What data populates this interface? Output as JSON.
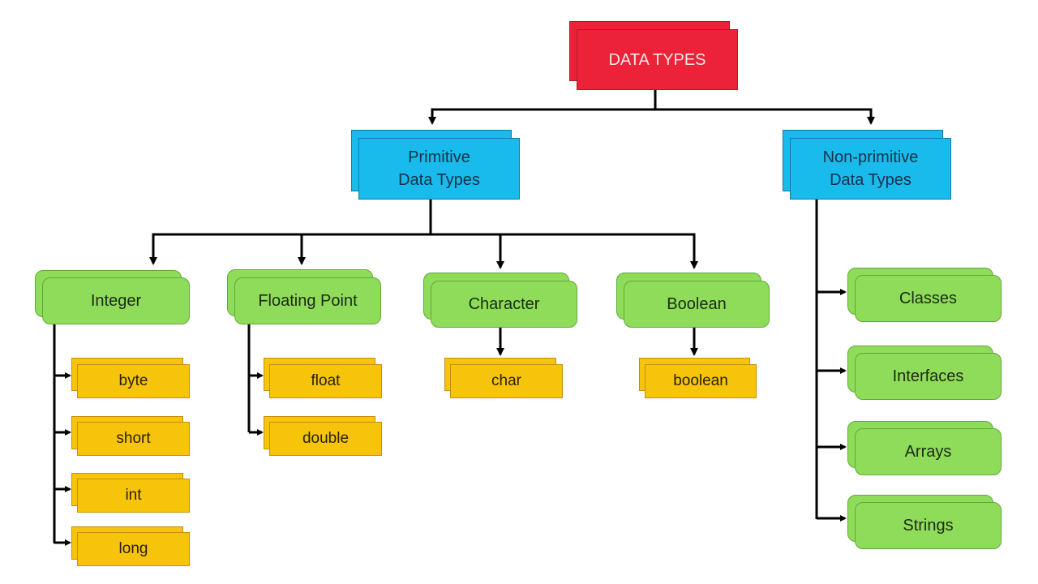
{
  "root": {
    "label": "DATA TYPES",
    "color": "#ec2239"
  },
  "categories": [
    {
      "label_line1": "Primitive",
      "label_line2": "Data Types",
      "color": "#18bbec"
    },
    {
      "label_line1": "Non-primitive",
      "label_line2": "Data Types",
      "color": "#18bbec"
    }
  ],
  "primitive_groups": [
    {
      "label": "Integer",
      "children": [
        "byte",
        "short",
        "int",
        "long"
      ]
    },
    {
      "label": "Floating Point",
      "children": [
        "float",
        "double"
      ]
    },
    {
      "label": "Character",
      "children": [
        "char"
      ]
    },
    {
      "label": "Boolean",
      "children": [
        "boolean"
      ]
    }
  ],
  "non_primitive": [
    "Classes",
    "Interfaces",
    "Arrays",
    "Strings"
  ],
  "colors": {
    "group": "#8fdc5a",
    "leaf": "#f7c40c",
    "connector": "#000000"
  }
}
